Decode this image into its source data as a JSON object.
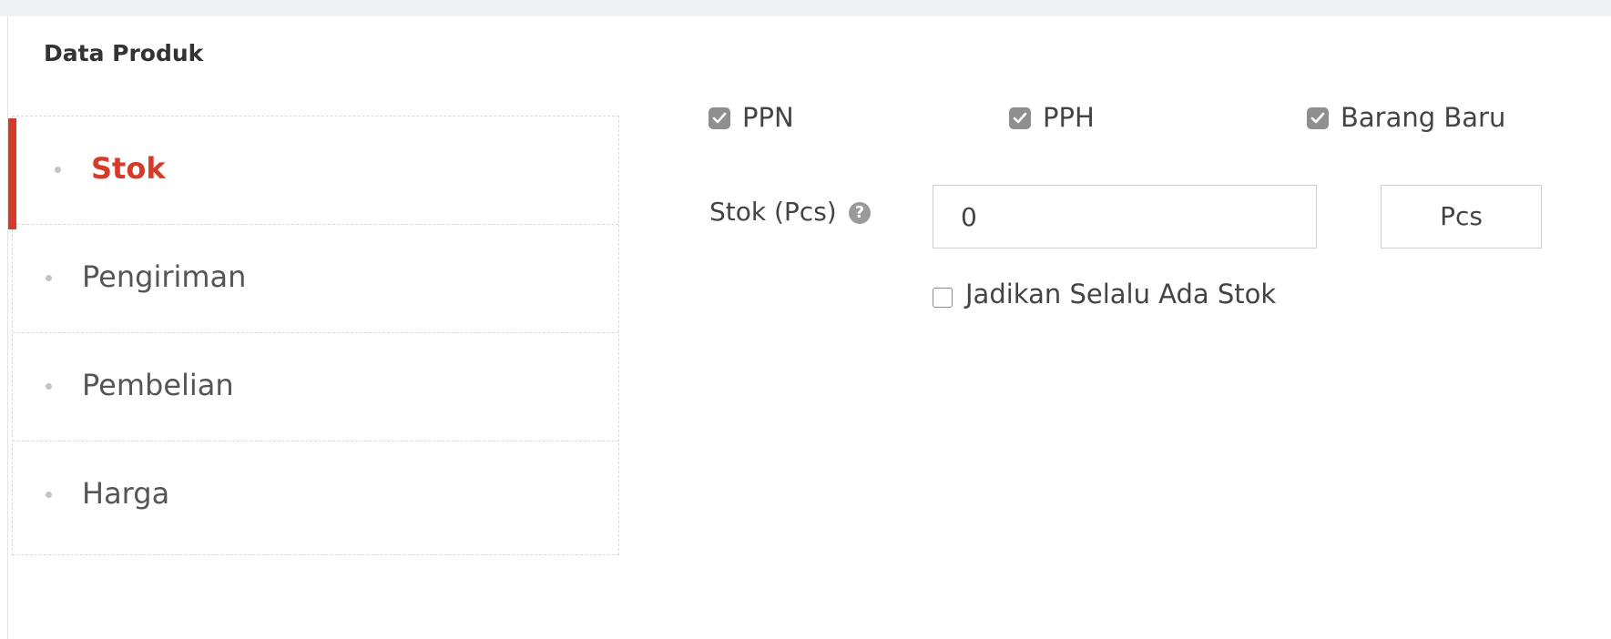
{
  "section_title": "Data Produk",
  "tabs": [
    {
      "label": "Stok",
      "active": true
    },
    {
      "label": "Pengiriman",
      "active": false
    },
    {
      "label": "Pembelian",
      "active": false
    },
    {
      "label": "Harga",
      "active": false
    }
  ],
  "checkboxes": [
    {
      "label": "PPN",
      "checked": true
    },
    {
      "label": "PPH",
      "checked": true
    },
    {
      "label": "Barang Baru",
      "checked": true
    }
  ],
  "stock": {
    "label": "Stok (Pcs)",
    "help_icon": "question-circle-icon",
    "value": "0",
    "unit": "Pcs",
    "always_in_stock_label": "Jadikan Selalu Ada Stok",
    "always_in_stock_checked": false
  },
  "colors": {
    "accent": "#d63b2a",
    "checkbox_fill": "#8f8f8f"
  }
}
